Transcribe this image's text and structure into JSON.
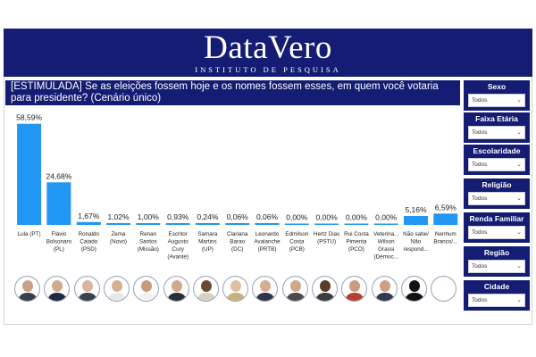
{
  "header": {
    "brand": "DataVero",
    "tagline": "INSTITUTO DE PESQUISA"
  },
  "question": "[ESTIMULADA] Se as eleições fossem hoje e os nomes fossem esses, em quem você votaria para presidente? (Cenário único)",
  "colors": {
    "brand_navy": "#141d73",
    "bar": "#2196f3"
  },
  "chart_data": {
    "type": "bar",
    "categories": [
      [
        "Lula (PT)"
      ],
      [
        "Flávio",
        "Bolsonaro",
        "(PL)"
      ],
      [
        "Ronaldo",
        "Caiado",
        "(PSD)"
      ],
      [
        "Zema",
        "(Novo)"
      ],
      [
        "Renan",
        "Santos",
        "(Missão)"
      ],
      [
        "Escritor",
        "Augusto",
        "Cury",
        "(Avante)"
      ],
      [
        "Samara",
        "Martins",
        "(UP)"
      ],
      [
        "Clariana",
        "Barao",
        "(DC)"
      ],
      [
        "Leonardo",
        "Avalanche",
        "(PRTB)"
      ],
      [
        "Edmilson",
        "Costa",
        "(PCB)"
      ],
      [
        "Hertz Dias",
        "(PSTU)"
      ],
      [
        "Rui Costa",
        "Pimenta",
        "(PCO)"
      ],
      [
        "Veterina...",
        "Wilson",
        "Grassi",
        "(Democ..."
      ],
      [
        "Não sabe/",
        "Não",
        "respond..."
      ],
      [
        "Nenhum",
        "Branco/..."
      ]
    ],
    "values": [
      58.59,
      24.68,
      1.67,
      1.02,
      1.0,
      0.93,
      0.24,
      0.06,
      0.06,
      0.0,
      0.0,
      0.0,
      0.0,
      5.16,
      6.59
    ],
    "data_labels": [
      "58,59%",
      "24,68%",
      "1,67%",
      "1,02%",
      "1,00%",
      "0,93%",
      "0,24%",
      "0,06%",
      "0,06%",
      "0,00%",
      "0,00%",
      "0,00%",
      "0,00%",
      "5,16%",
      "6,59%"
    ],
    "ylim": [
      0,
      60
    ],
    "grid": false,
    "legend": "none"
  },
  "candidate_photos": [
    {
      "icon": "candidate-photo",
      "skin": "#c9a088",
      "shirt": "#3a3f4a"
    },
    {
      "icon": "candidate-photo",
      "skin": "#d2a98c",
      "shirt": "#1f2a44"
    },
    {
      "icon": "candidate-photo",
      "skin": "#d8b59c",
      "shirt": "#39424f"
    },
    {
      "icon": "candidate-photo",
      "skin": "#d6b095",
      "shirt": "#e8e8e8"
    },
    {
      "icon": "candidate-photo",
      "skin": "#c99a7a",
      "shirt": "#f2f2f2"
    },
    {
      "icon": "candidate-photo",
      "skin": "#d0a88c",
      "shirt": "#2b2f3a"
    },
    {
      "icon": "candidate-photo",
      "skin": "#6b4a35",
      "shirt": "#d8d0c0"
    },
    {
      "icon": "candidate-photo",
      "skin": "#e0bfa0",
      "shirt": "#c9b27a"
    },
    {
      "icon": "candidate-photo",
      "skin": "#d4ac90",
      "shirt": "#2e3548"
    },
    {
      "icon": "candidate-photo",
      "skin": "#cfa98e",
      "shirt": "#4a4a4a"
    },
    {
      "icon": "candidate-photo",
      "skin": "#5a3e2c",
      "shirt": "#3c3c3c"
    },
    {
      "icon": "candidate-photo",
      "skin": "#c79c80",
      "shirt": "#b3402f"
    },
    {
      "icon": "candidate-photo",
      "skin": "#cda083",
      "shirt": "#2f3a4c"
    },
    {
      "icon": "silhouette-icon",
      "skin": "#111111",
      "shirt": "#111111"
    },
    {
      "icon": "blank-circle",
      "skin": "#ffffff",
      "shirt": "#ffffff"
    }
  ],
  "filters": [
    {
      "label": "Sexo",
      "value": "Todos"
    },
    {
      "label": "Faixa Etária",
      "value": "Todos"
    },
    {
      "label": "Escolaridade",
      "value": "Todos"
    },
    {
      "label": "Religião",
      "value": "Todos"
    },
    {
      "label": "Renda Familiar",
      "value": "Todos"
    },
    {
      "label": "Região",
      "value": "Todos"
    },
    {
      "label": "Cidade",
      "value": "Todos"
    }
  ]
}
